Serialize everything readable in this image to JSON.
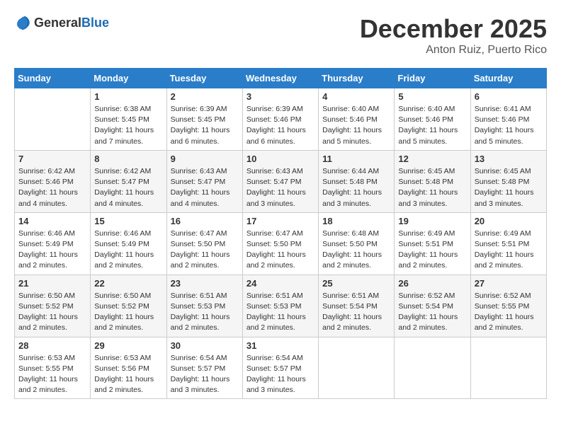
{
  "header": {
    "logo_general": "General",
    "logo_blue": "Blue",
    "month": "December 2025",
    "location": "Anton Ruiz, Puerto Rico"
  },
  "weekdays": [
    "Sunday",
    "Monday",
    "Tuesday",
    "Wednesday",
    "Thursday",
    "Friday",
    "Saturday"
  ],
  "weeks": [
    [
      {
        "day": "",
        "info": ""
      },
      {
        "day": "1",
        "info": "Sunrise: 6:38 AM\nSunset: 5:45 PM\nDaylight: 11 hours\nand 7 minutes."
      },
      {
        "day": "2",
        "info": "Sunrise: 6:39 AM\nSunset: 5:45 PM\nDaylight: 11 hours\nand 6 minutes."
      },
      {
        "day": "3",
        "info": "Sunrise: 6:39 AM\nSunset: 5:46 PM\nDaylight: 11 hours\nand 6 minutes."
      },
      {
        "day": "4",
        "info": "Sunrise: 6:40 AM\nSunset: 5:46 PM\nDaylight: 11 hours\nand 5 minutes."
      },
      {
        "day": "5",
        "info": "Sunrise: 6:40 AM\nSunset: 5:46 PM\nDaylight: 11 hours\nand 5 minutes."
      },
      {
        "day": "6",
        "info": "Sunrise: 6:41 AM\nSunset: 5:46 PM\nDaylight: 11 hours\nand 5 minutes."
      }
    ],
    [
      {
        "day": "7",
        "info": "Sunrise: 6:42 AM\nSunset: 5:46 PM\nDaylight: 11 hours\nand 4 minutes."
      },
      {
        "day": "8",
        "info": "Sunrise: 6:42 AM\nSunset: 5:47 PM\nDaylight: 11 hours\nand 4 minutes."
      },
      {
        "day": "9",
        "info": "Sunrise: 6:43 AM\nSunset: 5:47 PM\nDaylight: 11 hours\nand 4 minutes."
      },
      {
        "day": "10",
        "info": "Sunrise: 6:43 AM\nSunset: 5:47 PM\nDaylight: 11 hours\nand 3 minutes."
      },
      {
        "day": "11",
        "info": "Sunrise: 6:44 AM\nSunset: 5:48 PM\nDaylight: 11 hours\nand 3 minutes."
      },
      {
        "day": "12",
        "info": "Sunrise: 6:45 AM\nSunset: 5:48 PM\nDaylight: 11 hours\nand 3 minutes."
      },
      {
        "day": "13",
        "info": "Sunrise: 6:45 AM\nSunset: 5:48 PM\nDaylight: 11 hours\nand 3 minutes."
      }
    ],
    [
      {
        "day": "14",
        "info": "Sunrise: 6:46 AM\nSunset: 5:49 PM\nDaylight: 11 hours\nand 2 minutes."
      },
      {
        "day": "15",
        "info": "Sunrise: 6:46 AM\nSunset: 5:49 PM\nDaylight: 11 hours\nand 2 minutes."
      },
      {
        "day": "16",
        "info": "Sunrise: 6:47 AM\nSunset: 5:50 PM\nDaylight: 11 hours\nand 2 minutes."
      },
      {
        "day": "17",
        "info": "Sunrise: 6:47 AM\nSunset: 5:50 PM\nDaylight: 11 hours\nand 2 minutes."
      },
      {
        "day": "18",
        "info": "Sunrise: 6:48 AM\nSunset: 5:50 PM\nDaylight: 11 hours\nand 2 minutes."
      },
      {
        "day": "19",
        "info": "Sunrise: 6:49 AM\nSunset: 5:51 PM\nDaylight: 11 hours\nand 2 minutes."
      },
      {
        "day": "20",
        "info": "Sunrise: 6:49 AM\nSunset: 5:51 PM\nDaylight: 11 hours\nand 2 minutes."
      }
    ],
    [
      {
        "day": "21",
        "info": "Sunrise: 6:50 AM\nSunset: 5:52 PM\nDaylight: 11 hours\nand 2 minutes."
      },
      {
        "day": "22",
        "info": "Sunrise: 6:50 AM\nSunset: 5:52 PM\nDaylight: 11 hours\nand 2 minutes."
      },
      {
        "day": "23",
        "info": "Sunrise: 6:51 AM\nSunset: 5:53 PM\nDaylight: 11 hours\nand 2 minutes."
      },
      {
        "day": "24",
        "info": "Sunrise: 6:51 AM\nSunset: 5:53 PM\nDaylight: 11 hours\nand 2 minutes."
      },
      {
        "day": "25",
        "info": "Sunrise: 6:51 AM\nSunset: 5:54 PM\nDaylight: 11 hours\nand 2 minutes."
      },
      {
        "day": "26",
        "info": "Sunrise: 6:52 AM\nSunset: 5:54 PM\nDaylight: 11 hours\nand 2 minutes."
      },
      {
        "day": "27",
        "info": "Sunrise: 6:52 AM\nSunset: 5:55 PM\nDaylight: 11 hours\nand 2 minutes."
      }
    ],
    [
      {
        "day": "28",
        "info": "Sunrise: 6:53 AM\nSunset: 5:55 PM\nDaylight: 11 hours\nand 2 minutes."
      },
      {
        "day": "29",
        "info": "Sunrise: 6:53 AM\nSunset: 5:56 PM\nDaylight: 11 hours\nand 2 minutes."
      },
      {
        "day": "30",
        "info": "Sunrise: 6:54 AM\nSunset: 5:57 PM\nDaylight: 11 hours\nand 3 minutes."
      },
      {
        "day": "31",
        "info": "Sunrise: 6:54 AM\nSunset: 5:57 PM\nDaylight: 11 hours\nand 3 minutes."
      },
      {
        "day": "",
        "info": ""
      },
      {
        "day": "",
        "info": ""
      },
      {
        "day": "",
        "info": ""
      }
    ]
  ]
}
